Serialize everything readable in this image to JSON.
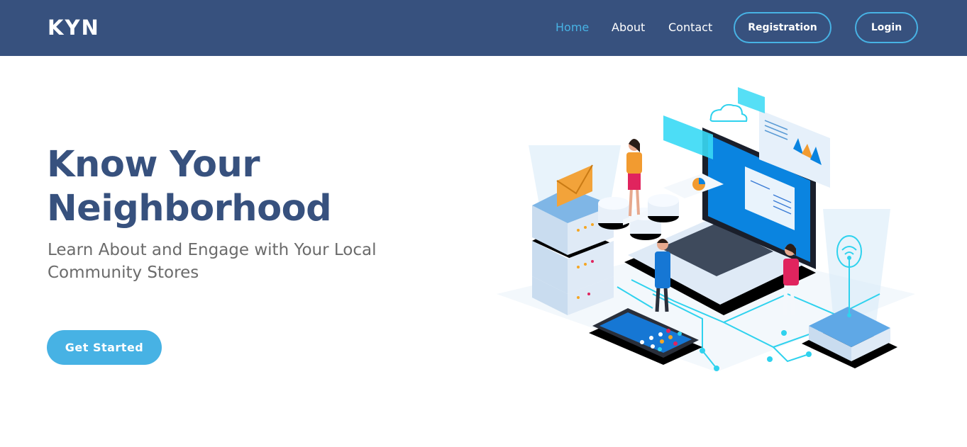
{
  "navbar": {
    "logo": "KYN",
    "links": [
      {
        "label": "Home",
        "active": true
      },
      {
        "label": "About",
        "active": false
      },
      {
        "label": "Contact",
        "active": false
      }
    ],
    "registration_label": "Registration",
    "login_label": "Login"
  },
  "hero": {
    "title_line1": "Know Your",
    "title_line2": "Neighborhood",
    "subtitle_line1": "Learn About and Engage with Your Local",
    "subtitle_line2": "Community Stores",
    "cta_label": "Get Started"
  },
  "colors": {
    "nav_bg": "#37517e",
    "accent": "#47b2e4",
    "title": "#37517e",
    "subtitle": "#6b6b6b"
  },
  "illustration": {
    "icon": "isometric-network-illustration"
  }
}
